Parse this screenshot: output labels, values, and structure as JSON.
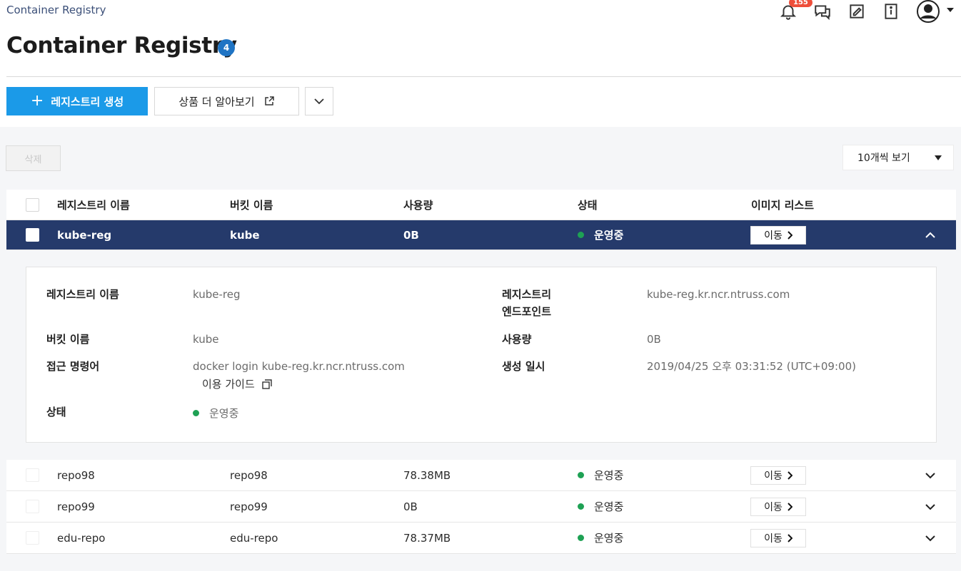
{
  "breadcrumb": "Container Registry",
  "header": {
    "notification_count": "155",
    "icons": [
      "bell-icon",
      "chat-icon",
      "memo-icon",
      "info-icon",
      "user-avatar-icon"
    ]
  },
  "page_title": "Container Registry",
  "title_badge": "4",
  "toolbar": {
    "create_label": "레지스트리 생성",
    "learn_label": "상품 더 알아보기"
  },
  "delete_label": "삭제",
  "per_page": "10개씩 보기",
  "table": {
    "headers": [
      "레지스트리 이름",
      "버킷 이름",
      "사용량",
      "상태",
      "이미지 리스트"
    ],
    "go_label": "이동",
    "rows": [
      {
        "name": "kube-reg",
        "bucket": "kube",
        "usage": "0B",
        "status": "운영중"
      },
      {
        "name": "repo98",
        "bucket": "repo98",
        "usage": "78.38MB",
        "status": "운영중"
      },
      {
        "name": "repo99",
        "bucket": "repo99",
        "usage": "0B",
        "status": "운영중"
      },
      {
        "name": "edu-repo",
        "bucket": "edu-repo",
        "usage": "78.37MB",
        "status": "운영중"
      }
    ]
  },
  "detail": {
    "registry_name_label": "레지스트리 이름",
    "registry_name": "kube-reg",
    "endpoint_label_1": "레지스트리",
    "endpoint_label_2": "엔드포인트",
    "endpoint": "kube-reg.kr.ncr.ntruss.com",
    "bucket_label": "버킷 이름",
    "bucket": "kube",
    "usage_label": "사용량",
    "usage": "0B",
    "access_label": "접근 명령어",
    "access_command": "docker login kube-reg.kr.ncr.ntruss.com",
    "guide_label": "이용 가이드",
    "created_label": "생성 일시",
    "created": "2019/04/25 오후 03:31:52 (UTC+09:00)",
    "status_label": "상태",
    "status": "운영중"
  },
  "colors": {
    "primary": "#1b9ae8",
    "selected_row": "#253a6b",
    "status_green": "#1ea154",
    "badge_red": "#ee4e3a"
  }
}
